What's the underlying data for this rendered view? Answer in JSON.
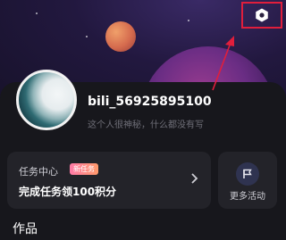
{
  "profile": {
    "username": "bili_56925895100",
    "bio": "这个人很神秘，什么都没有写"
  },
  "task_center": {
    "title": "任务中心",
    "badge": "新任务",
    "subtitle": "完成任务领100积分"
  },
  "more_activities": {
    "label": "更多活动",
    "icon": "flag-icon"
  },
  "section": {
    "works_title": "作品"
  },
  "header": {
    "settings_icon": "settings-hexagon-icon"
  },
  "colors": {
    "highlight_box": "#e01e3c",
    "badge": "#ff7ba8"
  }
}
